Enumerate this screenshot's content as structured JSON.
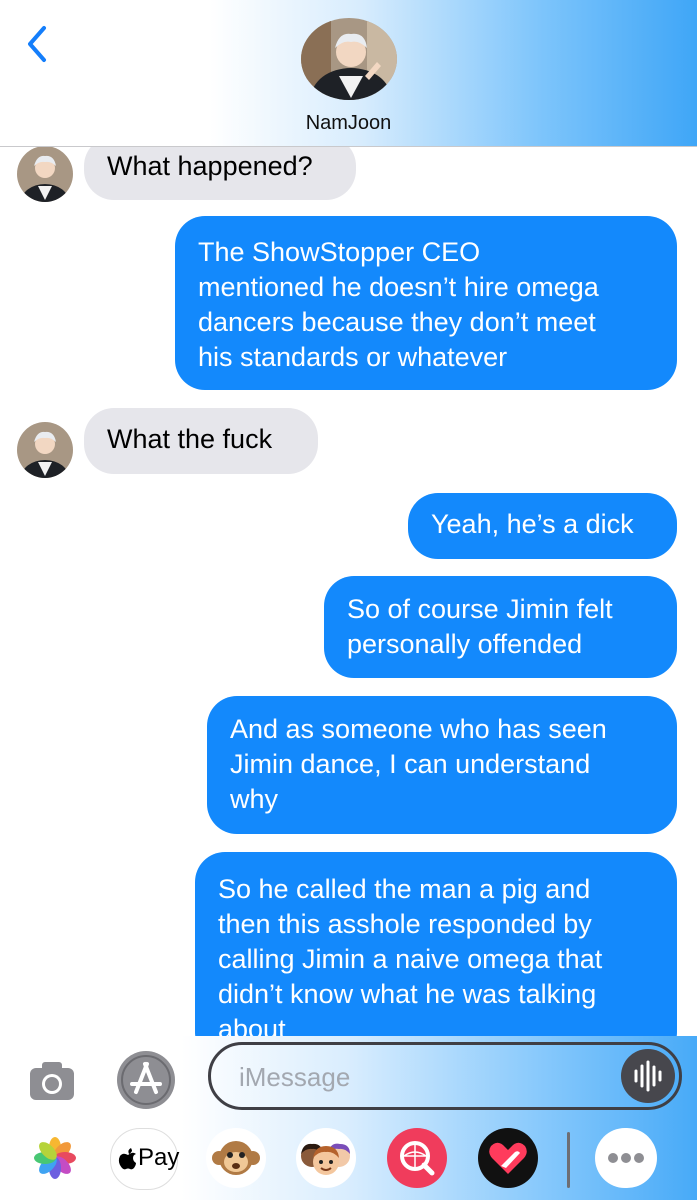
{
  "header": {
    "contact_name": "NamJoon",
    "back_icon": "chevron-left-icon",
    "accent_color": "#147efb"
  },
  "messages": [
    {
      "from": "them",
      "text": "What happened?"
    },
    {
      "from": "me",
      "lines": [
        "The ShowStopper CEO",
        "mentioned he doesn’t hire omega",
        "dancers because they don’t meet",
        "his standards or whatever"
      ]
    },
    {
      "from": "them",
      "text": "What the fuck"
    },
    {
      "from": "me",
      "text": "Yeah, he’s a dick"
    },
    {
      "from": "me",
      "lines": [
        "So of course Jimin felt",
        "personally offended"
      ]
    },
    {
      "from": "me",
      "lines": [
        "And as someone who has seen",
        "Jimin dance, I can understand",
        "why"
      ]
    },
    {
      "from": "me",
      "lines": [
        "So he called the man a pig and",
        "then this asshole responded by",
        "calling Jimin a naive omega that",
        "didn’t know what he was talking",
        "about"
      ]
    }
  ],
  "compose": {
    "placeholder": "iMessage",
    "camera_icon": "camera-icon",
    "apps_icon": "app-store-icon",
    "audio_icon": "audio-waveform-icon"
  },
  "app_strip": [
    {
      "name": "photos-app-icon"
    },
    {
      "name": "apple-pay-icon",
      "label": "Pay"
    },
    {
      "name": "animoji-icon"
    },
    {
      "name": "memoji-stickers-icon"
    },
    {
      "name": "images-search-icon"
    },
    {
      "name": "digital-touch-icon"
    },
    {
      "name": "more-apps-icon"
    }
  ],
  "colors": {
    "outgoing_bubble": "#1389fc",
    "incoming_bubble": "#e6e6eb"
  }
}
